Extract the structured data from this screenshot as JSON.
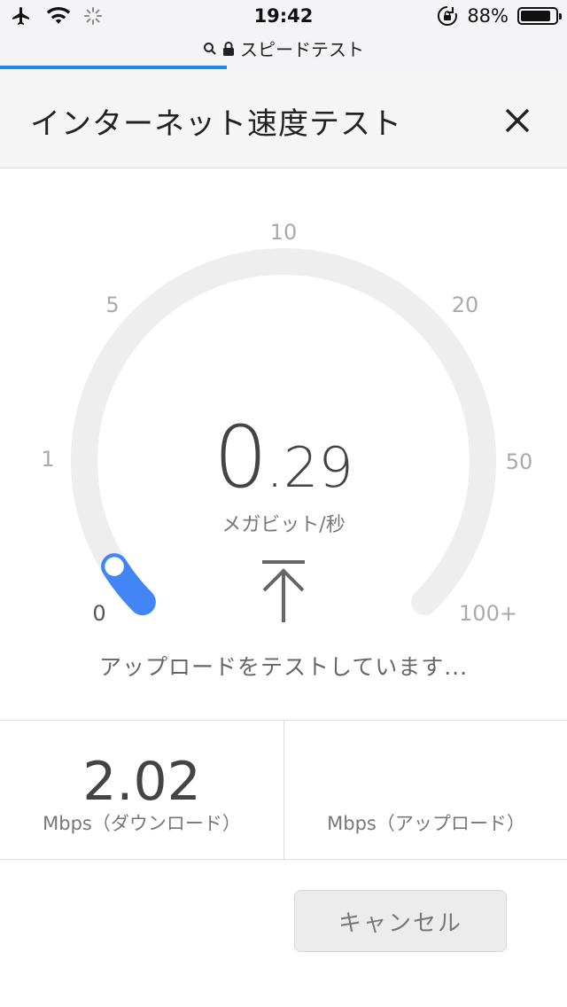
{
  "status_bar": {
    "time": "19:42",
    "battery": "88%",
    "battery_level": 0.88,
    "icons": [
      "airplane-icon",
      "wifi-icon",
      "activity-spinner-icon",
      "rotation-lock-icon",
      "battery-icon"
    ]
  },
  "url_bar": {
    "text": "スピードテスト",
    "icons": [
      "search-icon",
      "lock-icon"
    ],
    "load_progress": 0.4
  },
  "header": {
    "title": "インターネット速度テスト",
    "close_icon": "close-icon"
  },
  "gauge": {
    "ticks": [
      "0",
      "1",
      "5",
      "10",
      "20",
      "50",
      "100+"
    ],
    "value_int": "0",
    "value_dec": ".29",
    "unit": "メガビット/秒",
    "accent_color": "#4285f4",
    "track_color": "#eeeeee",
    "direction_icon": "upload-arrow-icon"
  },
  "status_text": "アップロードをテストしています...",
  "results": {
    "download": {
      "value": "2.02",
      "label": "Mbps（ダウンロード）"
    },
    "upload": {
      "value": "",
      "label": "Mbps（アップロード）"
    }
  },
  "cancel_label": "キャンセル"
}
